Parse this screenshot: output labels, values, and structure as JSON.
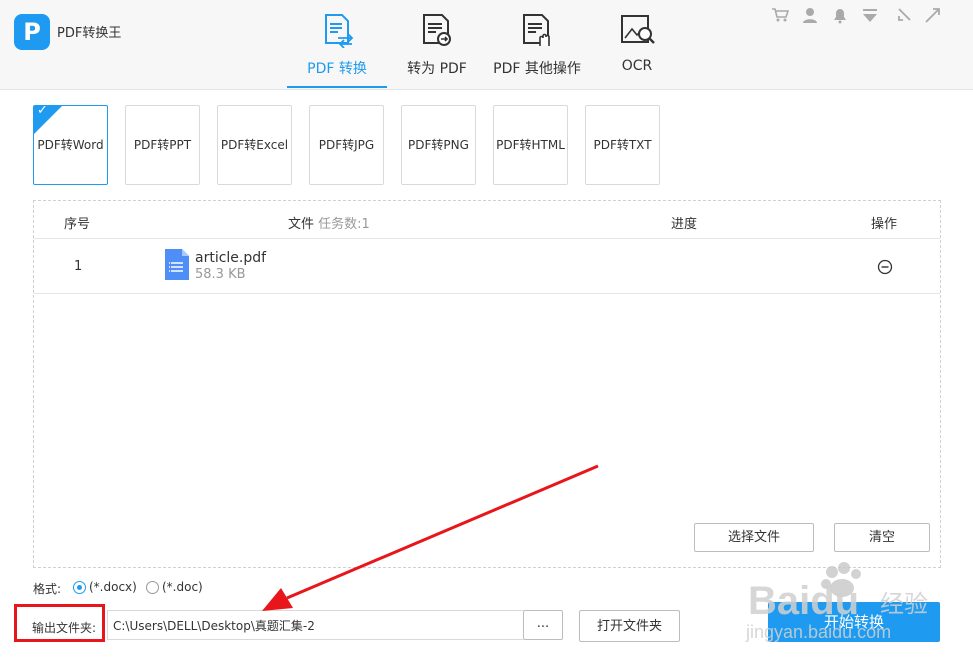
{
  "app": {
    "title": "PDF转换王",
    "logo_letter": "P",
    "brand_color": "#1e9bf0"
  },
  "tabs": [
    {
      "label": "PDF 转换",
      "icon": "pdf-convert-icon",
      "active": true
    },
    {
      "label": "转为 PDF",
      "icon": "to-pdf-icon",
      "active": false
    },
    {
      "label": "PDF 其他操作",
      "icon": "pdf-other-icon",
      "active": false
    },
    {
      "label": "OCR",
      "icon": "ocr-icon",
      "active": false
    }
  ],
  "titlebar_icons": [
    "cart-icon",
    "user-icon",
    "bell-icon",
    "dropdown-icon",
    "minimize-icon",
    "maximize-icon"
  ],
  "formats": [
    {
      "label": "PDF转Word",
      "selected": true
    },
    {
      "label": "PDF转PPT",
      "selected": false
    },
    {
      "label": "PDF转Excel",
      "selected": false
    },
    {
      "label": "PDF转JPG",
      "selected": false
    },
    {
      "label": "PDF转PNG",
      "selected": false
    },
    {
      "label": "PDF转HTML",
      "selected": false
    },
    {
      "label": "PDF转TXT",
      "selected": false
    }
  ],
  "table": {
    "col_index": "序号",
    "col_file": "文件",
    "task_count": "任务数:1",
    "col_progress": "进度",
    "col_action": "操作",
    "rows": [
      {
        "index": "1",
        "name": "article.pdf",
        "size": "58.3 KB"
      }
    ]
  },
  "buttons": {
    "select_file": "选择文件",
    "clear": "清空",
    "browse": "...",
    "open_folder": "打开文件夹",
    "start": "开始转换"
  },
  "format_options": {
    "label": "格式:",
    "options": [
      "(*.docx)",
      "(*.doc)"
    ],
    "selected": "(*.docx)"
  },
  "output": {
    "label": "输出文件夹:",
    "path": "C:\\Users\\DELL\\Desktop\\真题汇集-2"
  },
  "watermark": {
    "brand": "Baidu",
    "sub": "经验",
    "url": "jingyan.baidu.com"
  },
  "annotation_color": "#e8151b"
}
